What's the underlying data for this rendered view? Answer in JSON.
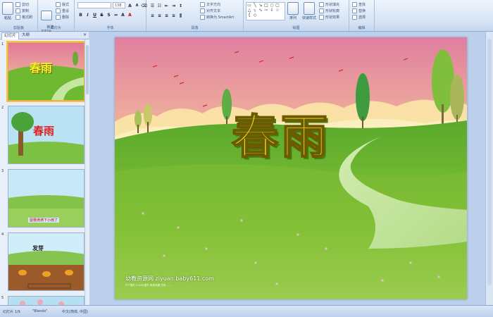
{
  "ribbon": {
    "clipboard": {
      "label": "剪贴板",
      "paste": "粘贴",
      "cut": "剪切",
      "copy": "复制",
      "format_painter": "格式刷"
    },
    "slides": {
      "label": "幻灯片",
      "new_slide": "新建\n幻灯片",
      "layout": "版式",
      "reset": "重设",
      "delete": "删除"
    },
    "font": {
      "label": "字体",
      "font_size": "138"
    },
    "paragraph": {
      "label": "段落",
      "text_direction": "文字方向",
      "align_text": "对齐文本",
      "convert_smartart": "转换为 SmartArt"
    },
    "drawing": {
      "label": "绘图",
      "arrange": "排列",
      "quick_styles": "快速样式",
      "shape_fill": "形状填充",
      "shape_outline": "形状轮廓",
      "shape_effects": "形状效果"
    },
    "editing": {
      "label": "编辑",
      "find": "查找",
      "replace": "替换",
      "select": "选择"
    }
  },
  "panel_tabs": {
    "slides_tab": "幻灯片",
    "outline_tab": "大纲"
  },
  "thumbnails": [
    {
      "num": "1",
      "title": "春雨"
    },
    {
      "num": "2",
      "title": "春雨"
    },
    {
      "num": "3",
      "caption": "屋檐滴滴下小雨了"
    },
    {
      "num": "4",
      "title": "发芽"
    },
    {
      "num": "5"
    }
  ],
  "slide": {
    "title": "春雨",
    "footer": "幼教资源网 ziyuan.baby611.com",
    "footer_small": "PPT课件 FLASH课件 教案快题 试卷 ……"
  },
  "status": {
    "slide_of": "幻灯片 1/9",
    "theme": "\"Blends\"",
    "language": "中文(简体, 中国)"
  },
  "colors": {
    "title_fill": "#f6f02a",
    "title_stroke": "#6b5a00",
    "thumb2_title": "#e02020",
    "selection": "#f2c14e"
  }
}
